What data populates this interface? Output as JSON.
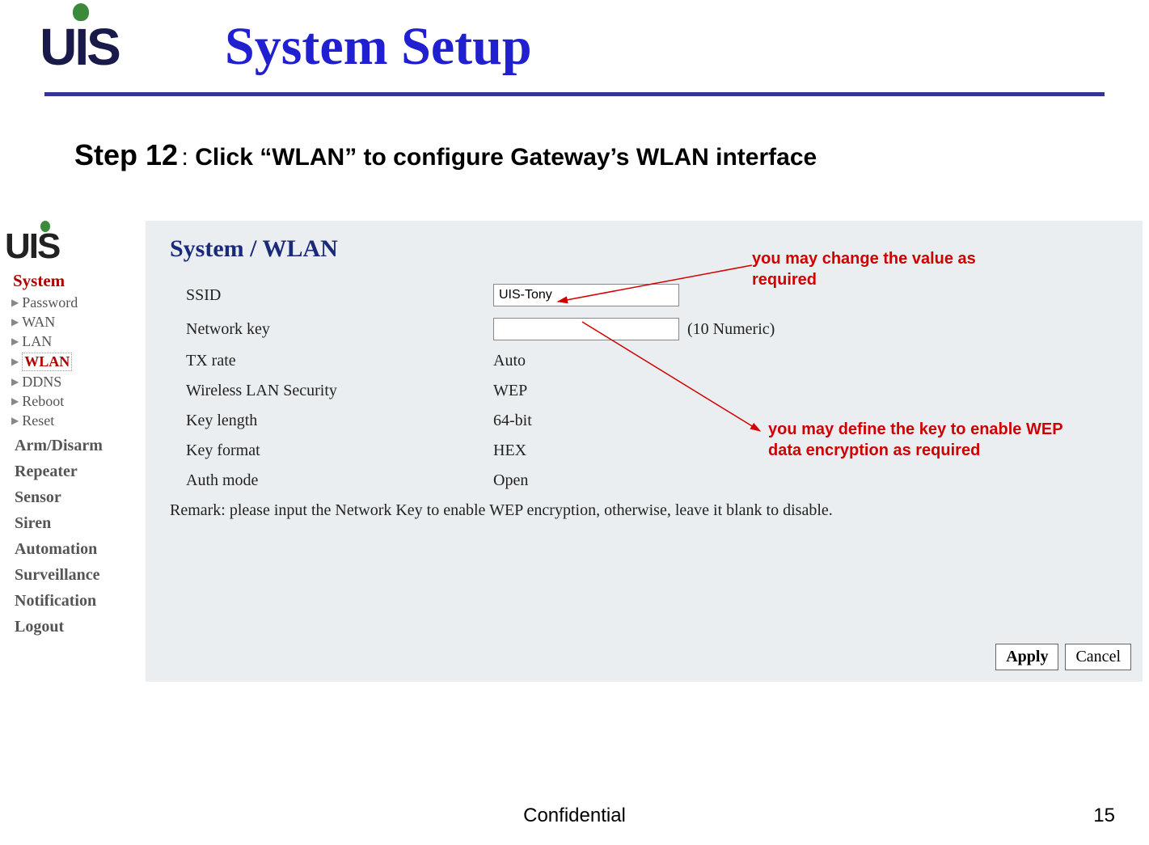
{
  "header": {
    "logo": "UIS",
    "title": "System Setup"
  },
  "step": {
    "label": "Step 12",
    "text": "Click “WLAN” to configure Gateway’s WLAN interface"
  },
  "sidebar": {
    "logo": "UIS",
    "system_label": "System",
    "items": [
      "Password",
      "WAN",
      "LAN",
      "WLAN",
      "DDNS",
      "Reboot",
      "Reset"
    ],
    "categories": [
      "Arm/Disarm",
      "Repeater",
      "Sensor",
      "Siren",
      "Automation",
      "Surveillance",
      "Notification",
      "Logout"
    ]
  },
  "panel": {
    "title": "System / WLAN",
    "rows": {
      "ssid_label": "SSID",
      "ssid_value": "UIS-Tony",
      "netkey_label": "Network key",
      "netkey_value": "",
      "netkey_hint": "(10 Numeric)",
      "txrate_label": "TX rate",
      "txrate_value": "Auto",
      "security_label": "Wireless LAN Security",
      "security_value": "WEP",
      "keylen_label": "Key length",
      "keylen_value": "64-bit",
      "keyfmt_label": "Key format",
      "keyfmt_value": "HEX",
      "auth_label": "Auth mode",
      "auth_value": "Open"
    },
    "remark": "Remark: please input the Network Key to enable WEP encryption, otherwise, leave it blank to disable.",
    "buttons": {
      "apply": "Apply",
      "cancel": "Cancel"
    }
  },
  "annotations": {
    "a1": "you may change the value as required",
    "a2": "you may define the key to enable WEP data encryption as required"
  },
  "footer": {
    "confidential": "Confidential",
    "page": "15"
  }
}
